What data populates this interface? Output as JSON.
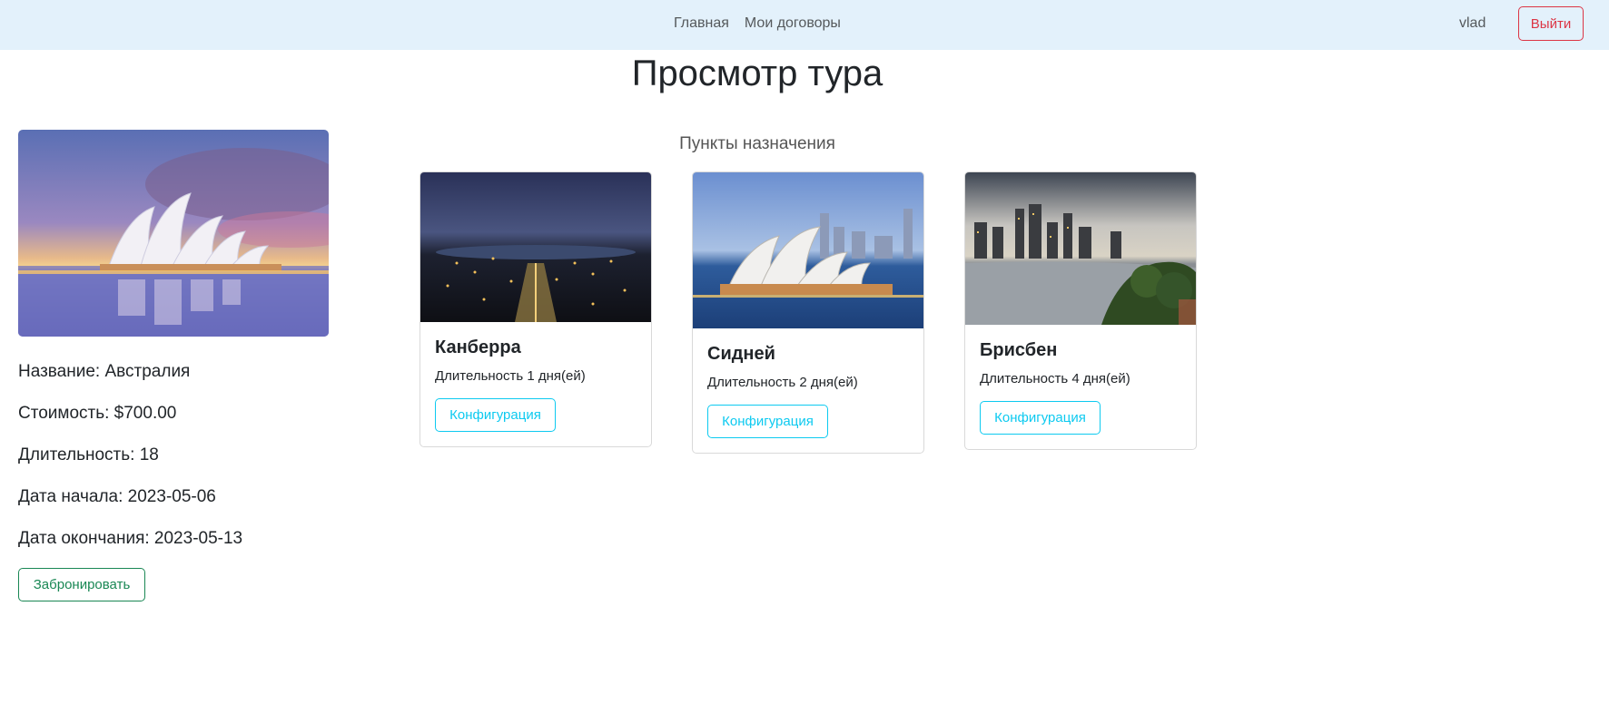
{
  "nav": {
    "links": [
      "Главная",
      "Мои договоры"
    ],
    "user": "vlad",
    "logout_label": "Выйти"
  },
  "page_title": "Просмотр тура",
  "tour": {
    "name_line": "Название: Австралия",
    "price_line": "Стоимость: $700.00",
    "duration_line": "Длительность: 18",
    "start_line": "Дата начала: 2023-05-06",
    "end_line": "Дата окончания: 2023-05-13",
    "book_label": "Забронировать"
  },
  "destinations": {
    "heading": "Пункты назначения",
    "cards": [
      {
        "title": "Канберра",
        "duration": "Длительность 1 дня(ей)",
        "button": "Конфигурация"
      },
      {
        "title": "Сидней",
        "duration": "Длительность 2 дня(ей)",
        "button": "Конфигурация"
      },
      {
        "title": "Брисбен",
        "duration": "Длительность 4 дня(ей)",
        "button": "Конфигурация"
      }
    ]
  },
  "colors": {
    "navbar_bg": "#e3f1fb",
    "danger": "#dc3545",
    "success": "#198754",
    "info": "#0dcaf0"
  }
}
